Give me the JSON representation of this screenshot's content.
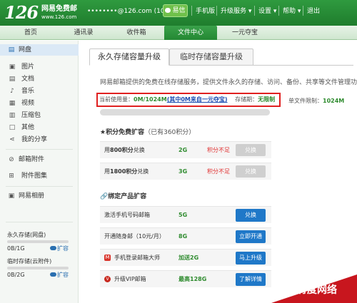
{
  "header": {
    "logo": "126",
    "logo_name": "网易免费邮",
    "logo_url": "www.126.com",
    "user_account": "••••••••@126.com (10)",
    "dropdown_arrow": "▾",
    "yixin": "易信",
    "links": [
      "手机版",
      "升级服务 ▾",
      "设置 ▾",
      "帮助 ▾",
      "退出"
    ]
  },
  "nav": {
    "tabs": [
      "首页",
      "通讯录",
      "收件箱",
      "文件中心",
      "一元夺宝"
    ],
    "active_index": 3
  },
  "sidebar": {
    "cloud_disk": "网盘",
    "items": [
      "图片",
      "文档",
      "音乐",
      "视频",
      "压缩包",
      "其他",
      "我的分享"
    ],
    "mail_attachments": "邮箱附件",
    "attachment_album": "附件图集",
    "netease_album": "网易相册",
    "quota_permanent": {
      "title": "永久存储(网盘)",
      "value": "0B/1G",
      "expand": "扩容"
    },
    "quota_temp": {
      "title": "临时存储(云附件)",
      "value": "0B/2G",
      "expand": "扩容"
    }
  },
  "page_tabs": [
    "永久存储容量升级",
    "临时存储容量升级"
  ],
  "main": {
    "description": "网易邮箱提供的免费在线存储服务，提供文件永久的存储、访问、备份、共享等文件管理功能。",
    "usage_label": "当前使用量：",
    "usage_value": "0M/1024M",
    "usage_link": "(其中0M来自一元夺宝)",
    "validity_label": "存储期：",
    "validity_value": "无限制",
    "single_limit_label": "单文件限制：",
    "single_limit_value": "1024M",
    "used_fraction": 0
  },
  "points_section": {
    "star": "★",
    "title": "积分免费扩容",
    "note": "（已有360积分）",
    "rows": [
      {
        "label_pre": "用",
        "points": "800积分",
        "label_post": "兑换",
        "size": "2G",
        "status": "积分不足",
        "button": "兑换"
      },
      {
        "label_pre": "用",
        "points": "1800积分",
        "label_post": "兑换",
        "size": "3G",
        "status": "积分不足",
        "button": "兑换"
      }
    ]
  },
  "bind_section": {
    "link_icon": "🔗",
    "title": "绑定产品扩容",
    "rows": [
      {
        "label": "激活手机号码邮箱",
        "size": "5G",
        "button": "兑换"
      },
      {
        "label": "开通随身邮（10元/月）",
        "size": "8G",
        "button": "立即开通"
      },
      {
        "label": "手机登录邮箱大师",
        "size": "加送2G",
        "button": "马上升级"
      },
      {
        "label": "升级VIP邮箱",
        "size": "最高128G",
        "button": "了解详情"
      }
    ]
  },
  "watermark": "有度网络",
  "colors": {
    "brand_green": "#2f9a3f",
    "action_blue": "#1f78c8",
    "alert_red": "#e02020"
  }
}
